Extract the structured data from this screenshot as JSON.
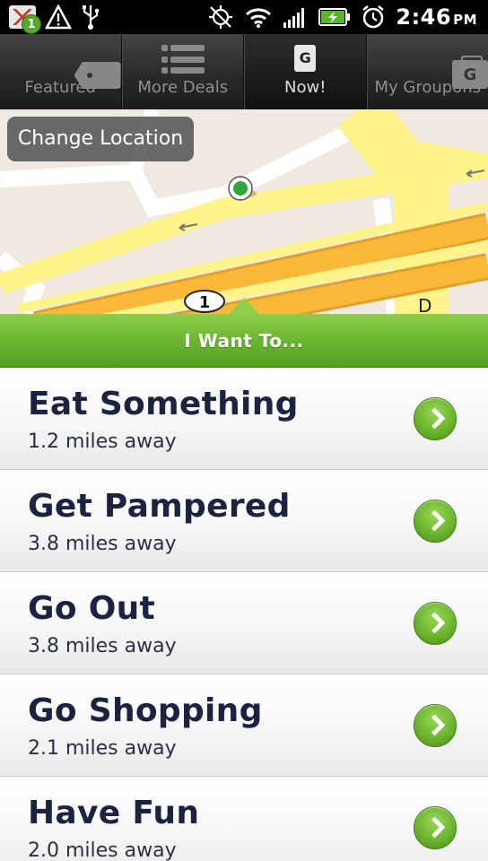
{
  "status_bar": {
    "notification_count": "1",
    "time": "2:46",
    "ampm": "PM",
    "icons": [
      "gmail-icon",
      "warning-icon",
      "usb-icon",
      "gps-off-icon",
      "wifi-icon",
      "signal-icon",
      "battery-charging-icon",
      "alarm-icon"
    ]
  },
  "tabs": [
    {
      "label": "Featured",
      "icon": "tag-icon"
    },
    {
      "label": "More Deals",
      "icon": "list-icon"
    },
    {
      "label": "Now!",
      "icon": "groupon-g-icon"
    },
    {
      "label": "My Groupons",
      "icon": "groupon-bag-icon"
    }
  ],
  "active_tab": "Now!",
  "map": {
    "change_location_label": "Change Location",
    "route_marker": "1"
  },
  "section_header": "I Want To...",
  "categories": [
    {
      "title": "Eat Something",
      "distance": "1.2 miles away"
    },
    {
      "title": "Get Pampered",
      "distance": "3.8 miles away"
    },
    {
      "title": "Go Out",
      "distance": "3.8 miles away"
    },
    {
      "title": "Go Shopping",
      "distance": "2.1 miles away"
    },
    {
      "title": "Have Fun",
      "distance": "2.0 miles away"
    }
  ],
  "colors": {
    "accent_green": "#6ab631",
    "title_navy": "#1c2340",
    "road_yellow": "#fff48c",
    "road_orange": "#f9b938"
  }
}
